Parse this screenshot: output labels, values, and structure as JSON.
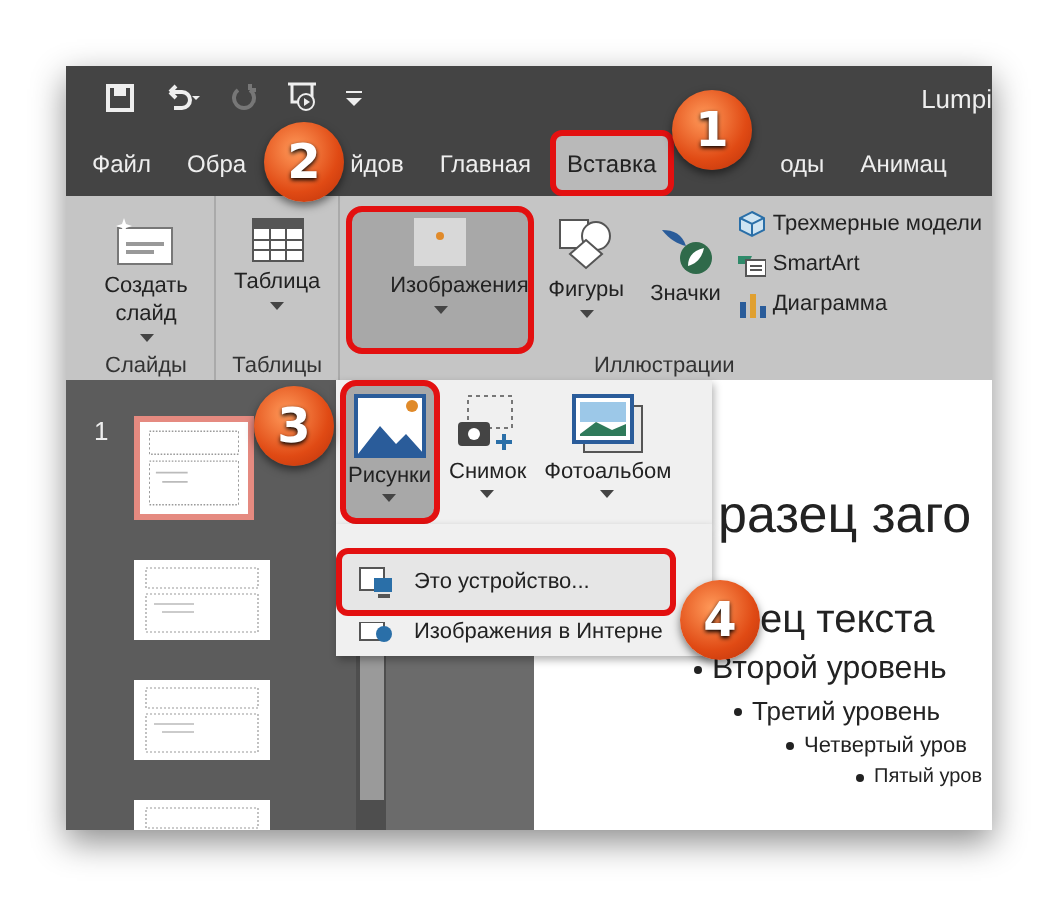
{
  "window": {
    "title": "Lumpi"
  },
  "tabs": [
    {
      "label_parts": [
        "Файл"
      ],
      "selected": false,
      "highlighted": false
    },
    {
      "label_parts": [
        "Обра",
        "йдов"
      ],
      "selected": false,
      "highlighted": false
    },
    {
      "label_parts": [
        "Главная"
      ],
      "selected": false,
      "highlighted": false
    },
    {
      "label_parts": [
        "Вставка"
      ],
      "selected": true,
      "highlighted": true
    },
    {
      "label_parts": [
        "оды"
      ],
      "selected": false,
      "highlighted": false
    },
    {
      "label_parts": [
        "Анимац"
      ],
      "selected": false,
      "highlighted": false
    }
  ],
  "ribbon": {
    "groups": [
      {
        "label": "Слайды",
        "buttons": [
          {
            "label": "Создать слайд",
            "dropdown": true,
            "pressed": false,
            "highlighted": false
          }
        ]
      },
      {
        "label": "Таблицы",
        "buttons": [
          {
            "label": "Таблица",
            "dropdown": true,
            "pressed": false,
            "highlighted": false
          }
        ]
      },
      {
        "label": "Иллюстрации",
        "buttons": [
          {
            "label": "Изображения",
            "dropdown": true,
            "pressed": true,
            "highlighted": true
          },
          {
            "label": "Фигуры",
            "dropdown": true,
            "pressed": false,
            "highlighted": false
          },
          {
            "label": "Значки",
            "dropdown": false,
            "pressed": false,
            "highlighted": false
          }
        ],
        "small_buttons": [
          {
            "label": "Трехмерные модели"
          },
          {
            "label": "SmartArt"
          },
          {
            "label": "Диаграмма"
          }
        ]
      }
    ]
  },
  "images_dropdown": {
    "buttons": [
      {
        "label": "Рисунки",
        "pressed": true,
        "highlighted": true
      },
      {
        "label": "Снимок",
        "pressed": false,
        "highlighted": false
      },
      {
        "label": "Фотоальбом",
        "pressed": false,
        "highlighted": false
      }
    ]
  },
  "insert_menu": {
    "items": [
      {
        "label": "Это устройство...",
        "highlighted": true
      },
      {
        "label": "Изображения в Интерне",
        "highlighted": false
      }
    ]
  },
  "slides": [
    {
      "number": "1",
      "selected": true
    },
    {
      "selected": false
    },
    {
      "selected": false
    },
    {
      "selected": false
    }
  ],
  "slide": {
    "title": "разец заго",
    "body": [
      {
        "text": "ец текста",
        "children": [
          {
            "text": "Второй уровень",
            "children": [
              {
                "text": "Третий уровень",
                "children": [
                  {
                    "text": "Четвертый уров",
                    "children": [
                      {
                        "text": "Пятый уров"
                      }
                    ]
                  }
                ]
              }
            ]
          }
        ]
      }
    ]
  },
  "markers": [
    {
      "label": "1"
    },
    {
      "label": "2"
    },
    {
      "label": "3"
    },
    {
      "label": "4"
    }
  ]
}
